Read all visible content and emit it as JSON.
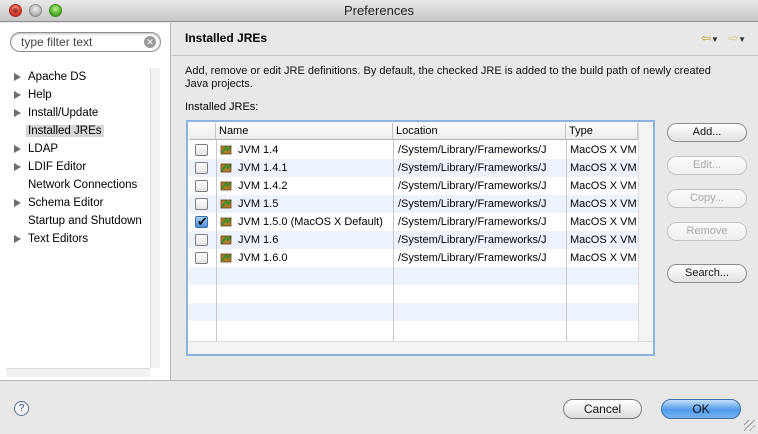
{
  "window": {
    "title": "Preferences"
  },
  "filter": {
    "placeholder": "type filter text"
  },
  "tree": {
    "items": [
      {
        "label": "Apache DS",
        "expandable": true,
        "selected": false
      },
      {
        "label": "Help",
        "expandable": true,
        "selected": false
      },
      {
        "label": "Install/Update",
        "expandable": true,
        "selected": false
      },
      {
        "label": "Installed JREs",
        "expandable": false,
        "selected": true
      },
      {
        "label": "LDAP",
        "expandable": true,
        "selected": false
      },
      {
        "label": "LDIF Editor",
        "expandable": true,
        "selected": false
      },
      {
        "label": "Network Connections",
        "expandable": false,
        "selected": false
      },
      {
        "label": "Schema Editor",
        "expandable": true,
        "selected": false
      },
      {
        "label": "Startup and Shutdown",
        "expandable": false,
        "selected": false
      },
      {
        "label": "Text Editors",
        "expandable": true,
        "selected": false
      }
    ]
  },
  "page": {
    "title": "Installed JREs",
    "description": "Add, remove or edit JRE definitions. By default, the checked JRE is added to the build path of newly created Java projects.",
    "table_label": "Installed JREs:"
  },
  "table": {
    "columns": [
      "Name",
      "Location",
      "Type"
    ],
    "rows": [
      {
        "checked": false,
        "name": "JVM 1.4",
        "location": "/System/Library/Frameworks/J",
        "type": "MacOS X VM"
      },
      {
        "checked": false,
        "name": "JVM 1.4.1",
        "location": "/System/Library/Frameworks/J",
        "type": "MacOS X VM"
      },
      {
        "checked": false,
        "name": "JVM 1.4.2",
        "location": "/System/Library/Frameworks/J",
        "type": "MacOS X VM"
      },
      {
        "checked": false,
        "name": "JVM 1.5",
        "location": "/System/Library/Frameworks/J",
        "type": "MacOS X VM"
      },
      {
        "checked": true,
        "name": "JVM 1.5.0 (MacOS X Default)",
        "location": "/System/Library/Frameworks/J",
        "type": "MacOS X VM"
      },
      {
        "checked": false,
        "name": "JVM 1.6",
        "location": "/System/Library/Frameworks/J",
        "type": "MacOS X VM"
      },
      {
        "checked": false,
        "name": "JVM 1.6.0",
        "location": "/System/Library/Frameworks/J",
        "type": "MacOS X VM"
      }
    ]
  },
  "buttons": {
    "add": "Add...",
    "edit": "Edit...",
    "copy": "Copy...",
    "remove": "Remove",
    "search": "Search...",
    "cancel": "Cancel",
    "ok": "OK",
    "help": "?"
  },
  "colors": {
    "accent": "#4f9bea",
    "selection": "#d6d6d6",
    "table_border": "#8cb2e0"
  }
}
